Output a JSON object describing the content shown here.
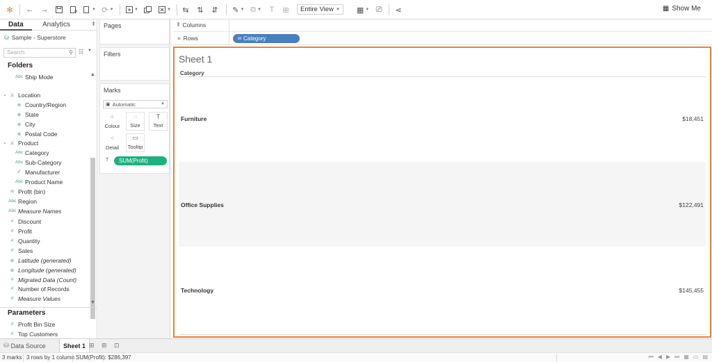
{
  "toolbar": {
    "view_mode": "Entire View",
    "show_me": "Show Me",
    "icons": [
      "tableau-logo-icon",
      "undo-icon",
      "redo-icon",
      "save-icon",
      "new-datasource-icon",
      "pause-icon",
      "refresh-icon",
      "new-worksheet-icon",
      "duplicate-icon",
      "clear-icon",
      "swap-icon",
      "sort-ascending-icon",
      "highlight-icon",
      "group-icon",
      "label-icon",
      "fix-axes-icon",
      "format-icon",
      "presentation-icon",
      "share-icon"
    ]
  },
  "data_pane": {
    "tab_data": "Data",
    "tab_analytics": "Analytics",
    "datasource": "Sample - Superstore",
    "search_placeholder": "Search",
    "folders_title": "Folders",
    "fields": [
      {
        "label": "Ship Mode",
        "icon": "Abc"
      },
      {
        "label": "Location",
        "icon": "person"
      },
      {
        "label": "Country/Region",
        "icon": "globe"
      },
      {
        "label": "State",
        "icon": "globe"
      },
      {
        "label": "City",
        "icon": "globe"
      },
      {
        "label": "Postal Code",
        "icon": "globe"
      },
      {
        "label": "Product",
        "icon": "person"
      },
      {
        "label": "Category",
        "icon": "Abc"
      },
      {
        "label": "Sub-Category",
        "icon": "Abc"
      },
      {
        "label": "Manufacturer",
        "icon": "link"
      },
      {
        "label": "Product Name",
        "icon": "Abc"
      },
      {
        "label": "Profit (bin)",
        "icon": "bin"
      },
      {
        "label": "Region",
        "icon": "Abc"
      },
      {
        "label": "Measure Names",
        "icon": "Abc"
      },
      {
        "label": "Discount",
        "icon": "#"
      },
      {
        "label": "Profit",
        "icon": "#"
      },
      {
        "label": "Quantity",
        "icon": "#"
      },
      {
        "label": "Sales",
        "icon": "#"
      },
      {
        "label": "Latitude (generated)",
        "icon": "globe"
      },
      {
        "label": "Longitude (generated)",
        "icon": "globe"
      },
      {
        "label": "Migrated Data (Count)",
        "icon": "#"
      },
      {
        "label": "Number of Records",
        "icon": "#"
      },
      {
        "label": "Measure Values",
        "icon": "#"
      }
    ],
    "parameters_title": "Parameters",
    "parameters": [
      "Profit Bin Size",
      "Top Customers"
    ]
  },
  "shelves": {
    "pages": "Pages",
    "filters": "Filters",
    "marks": "Marks",
    "mark_type": "Automatic",
    "mark_buttons": [
      "Colour",
      "Size",
      "Text",
      "Detail",
      "Tooltip"
    ],
    "marks_pill": "SUM(Profit)",
    "columns": "Columns",
    "rows": "Rows",
    "rows_pill": "Category"
  },
  "view": {
    "sheet_title": "Sheet 1",
    "header": "Category",
    "rows": [
      {
        "category": "Furniture",
        "value": "$18,451"
      },
      {
        "category": "Office Supplies",
        "value": "$122,491"
      },
      {
        "category": "Technology",
        "value": "$145,455"
      }
    ]
  },
  "tabs": {
    "data_source": "Data Source",
    "sheet1": "Sheet 1"
  },
  "status": {
    "marks": "3 marks",
    "dims": "3 rows by 1 column",
    "sum": "SUM(Profit): $286,397"
  },
  "colors": {
    "accent_orange": "#f07f2e",
    "pill_green": "#1eb17e",
    "pill_blue": "#4a7fbf"
  }
}
